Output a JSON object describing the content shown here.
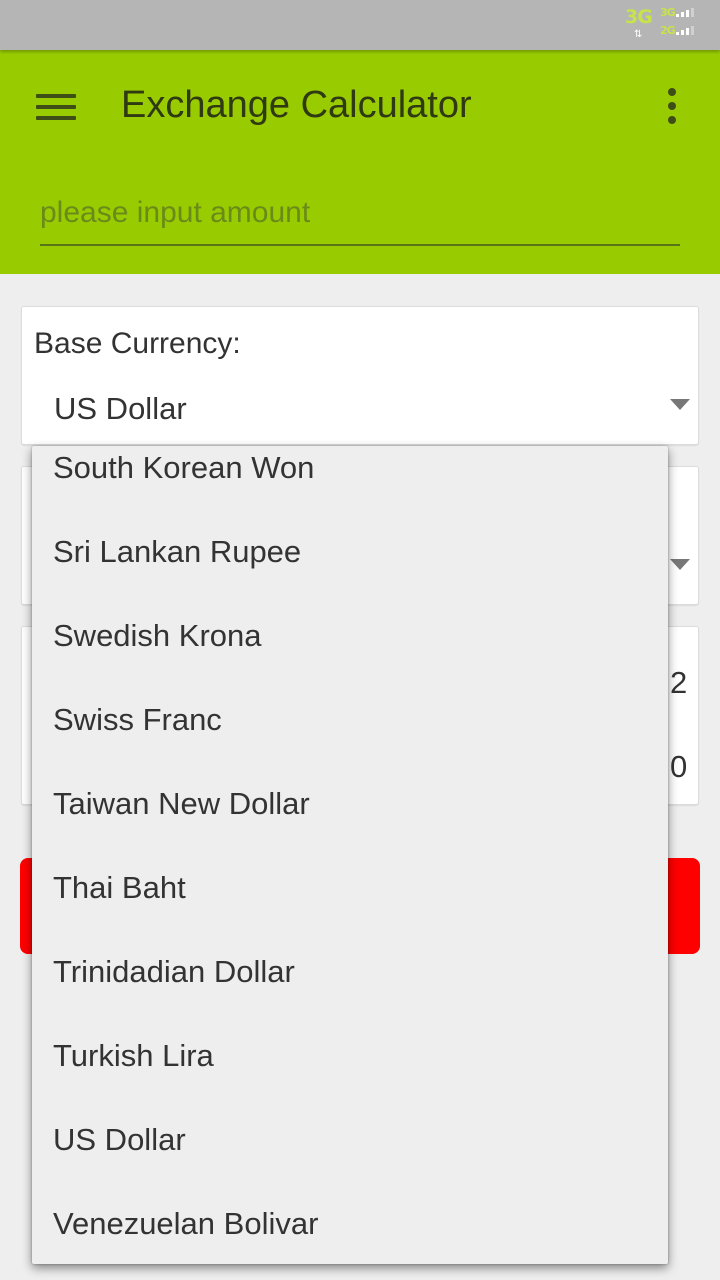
{
  "status_bar": {
    "network_primary": "3G",
    "network_top": "3G",
    "network_bottom": "2G"
  },
  "app_bar": {
    "title": "Exchange Calculator",
    "amount_placeholder": "please input amount",
    "amount_value": ""
  },
  "base_card": {
    "label": "Base Currency:",
    "selected": "US Dollar"
  },
  "result_card": {
    "digit_1": "2",
    "digit_2": "0"
  },
  "dropdown": {
    "items": [
      "South Korean Won",
      "Sri Lankan Rupee",
      "Swedish Krona",
      "Swiss Franc",
      "Taiwan New Dollar",
      "Thai Baht",
      "Trinidadian Dollar",
      "Turkish Lira",
      "US Dollar",
      "Venezuelan Bolivar"
    ]
  },
  "colors": {
    "app_bar": "#99cc00",
    "convert_button": "#ff0000",
    "background": "#eeeeee"
  },
  "icons": {
    "menu": "hamburger-menu-icon",
    "overflow": "more-vert-icon",
    "spinner": "dropdown-arrow-icon"
  }
}
